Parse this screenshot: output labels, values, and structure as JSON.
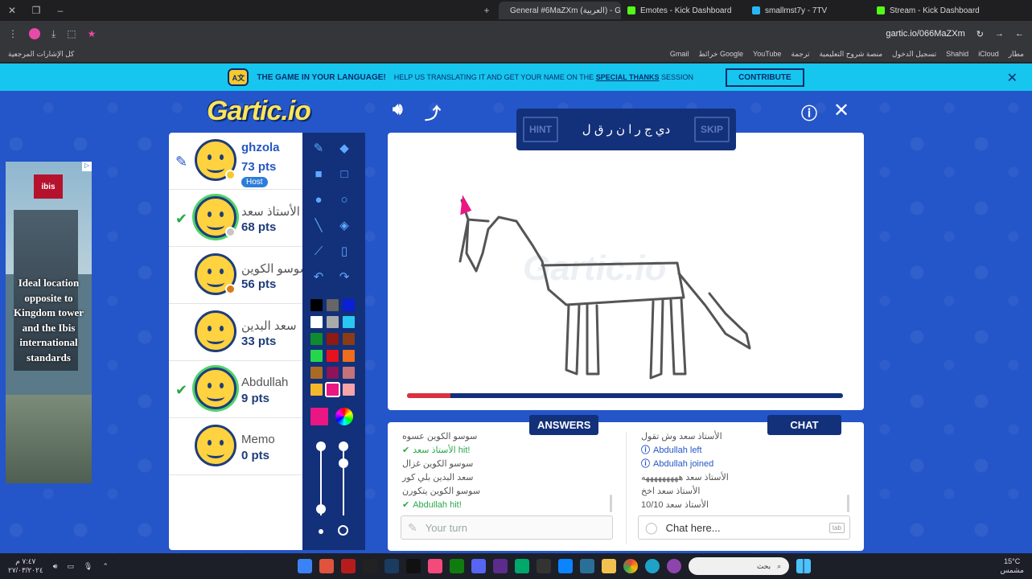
{
  "browser": {
    "tabs": [
      {
        "label": "General #6MaZXm (العربية) - Ga",
        "active": true,
        "color": "#3b82f6"
      },
      {
        "label": "Emotes - Kick Dashboard",
        "active": false,
        "color": "#53fc18"
      },
      {
        "label": "smallmst7y - 7TV",
        "active": false,
        "color": "#29b6f6"
      },
      {
        "label": "Stream - Kick Dashboard",
        "active": false,
        "color": "#53fc18"
      }
    ],
    "new_tab": "+",
    "address": "gartic.io/066MaZXm",
    "bookmarks_left": "كل الإشارات المرجعية",
    "bookmarks": [
      "Gmail",
      "خرائط Google",
      "YouTube",
      "ترجمة",
      "منصة شروح التعليمية",
      "تسجيل الدخول",
      "Shahid",
      "iCloud",
      "مطار"
    ]
  },
  "banner": {
    "title": "THE GAME IN YOUR LANGUAGE!",
    "message": "HELP US TRANSLATING IT AND GET YOUR NAME ON THE",
    "link": "SPECIAL THANKS",
    "message_end": "SESSION",
    "button": "CONTRIBUTE"
  },
  "ad": {
    "logo": "ibis",
    "text": "Ideal location opposite to Kingdom tower and the Ibis international standards"
  },
  "game": {
    "logo": "Gartic.io",
    "hint_label": "HINT",
    "skip_label": "SKIP",
    "word": "دي ج ر   ا ن ر ق ل",
    "watermark": "Gartic.io",
    "timer_fraction": 0.1,
    "answers_tab": "ANSWERS",
    "chat_tab": "CHAT",
    "answer_placeholder": "Your turn",
    "chat_placeholder": "Chat here...",
    "tab_hint": "tab"
  },
  "players": [
    {
      "name": "ghzola",
      "points": "73 pts",
      "mark": "pencil",
      "host": "Host",
      "me": true,
      "dot": "#f6c92e"
    },
    {
      "name": "الأستاذ سعد",
      "points": "68 pts",
      "mark": "check",
      "dot": "#c6c6c6"
    },
    {
      "name": "سوسو الكوين",
      "points": "56 pts",
      "mark": "",
      "dot": "#d97a17"
    },
    {
      "name": "سعد البدين",
      "points": "33 pts",
      "mark": "",
      "dot": ""
    },
    {
      "name": "Abdullah",
      "points": "9 pts",
      "mark": "check",
      "dot": ""
    },
    {
      "name": "Memo",
      "points": "0 pts",
      "mark": "",
      "dot": ""
    }
  ],
  "answers": [
    {
      "text": "سوسو الكوين عسوه",
      "type": "plain"
    },
    {
      "text": "الأستاذ سعد hit!",
      "type": "hit"
    },
    {
      "text": "سوسو الكوين غزال",
      "type": "plain"
    },
    {
      "text": "سعد البدين بلي كور",
      "type": "plain"
    },
    {
      "text": "سوسو الكوين يتكورن",
      "type": "plain"
    },
    {
      "text": "Abdullah hit!",
      "type": "hit"
    }
  ],
  "chat": [
    {
      "text": "الأستاذ سعد وش تقول",
      "type": "plain"
    },
    {
      "text": "Abdullah left",
      "type": "info"
    },
    {
      "text": "Abdullah joined",
      "type": "info"
    },
    {
      "text": "الأستاذ سعد هههههههههه",
      "type": "plain"
    },
    {
      "text": "الأستاذ سعد اخخ",
      "type": "plain"
    },
    {
      "text": "10/10 الأستاذ سعد",
      "type": "plain"
    }
  ],
  "palette": [
    [
      "#000000",
      "#666666",
      "#0a1fd6"
    ],
    [
      "#ffffff",
      "#aaaaaa",
      "#29c8f0"
    ],
    [
      "#0f8a2c",
      "#8e1a12",
      "#8a3c16"
    ],
    [
      "#26d64a",
      "#e6121c",
      "#ef6d1b"
    ],
    [
      "#a96b23",
      "#8e1358",
      "#c4737a"
    ],
    [
      "#f5b72a",
      "#ea1683",
      "#f6a4a8"
    ]
  ],
  "current_color": "#ea1683",
  "taskbar": {
    "time": "٧:٤٧ م",
    "date": "٢٧/٠٣/٢٠٢٤",
    "search": "بحث",
    "temp": "15°C",
    "weather": "مشمس"
  }
}
